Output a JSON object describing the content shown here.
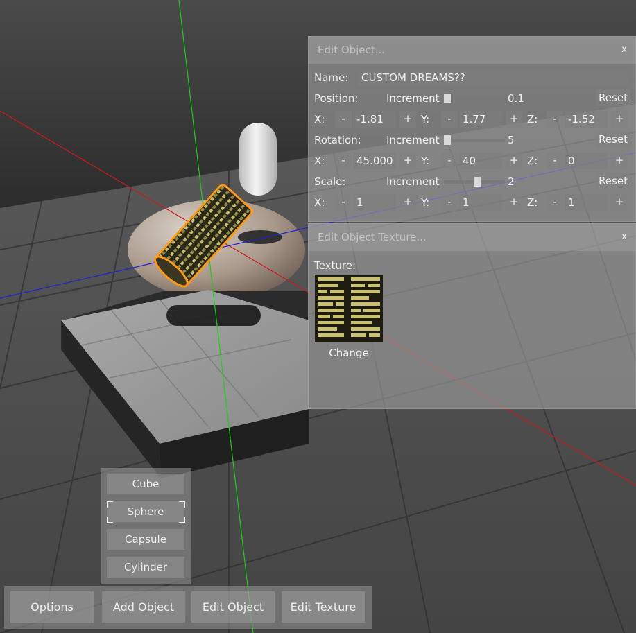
{
  "edit_object": {
    "title": "Edit Object...",
    "close": "x",
    "name_label": "Name:",
    "name_value": "CUSTOM DREAMS??",
    "position": {
      "label": "Position:",
      "increment_label": "Increment",
      "increment_value": "0.1",
      "increment_fraction": 0.0,
      "reset": "Reset",
      "x_label": "X:",
      "x": "-1.81",
      "y_label": "Y:",
      "y": "1.77",
      "z_label": "Z:",
      "z": "-1.52"
    },
    "rotation": {
      "label": "Rotation:",
      "increment_label": "Increment",
      "increment_value": "5",
      "increment_fraction": 0.0,
      "reset": "Reset",
      "x_label": "X:",
      "x": "45.000",
      "y_label": "Y:",
      "y": "40",
      "z_label": "Z:",
      "z": "0"
    },
    "scale": {
      "label": "Scale:",
      "increment_label": "Increment",
      "increment_value": "2",
      "increment_fraction": 0.55,
      "reset": "Reset",
      "x_label": "X:",
      "x": "1",
      "y_label": "Y:",
      "y": "1",
      "z_label": "Z:",
      "z": "1"
    },
    "minus": "-",
    "plus": "+"
  },
  "edit_texture": {
    "title": "Edit Object Texture...",
    "close": "x",
    "texture_label": "Texture:",
    "change_button": "Change"
  },
  "shape_menu": {
    "items": [
      "Cube",
      "Sphere",
      "Capsule",
      "Cylinder"
    ],
    "selected": "Sphere"
  },
  "bottom_bar": {
    "options": "Options",
    "add_object": "Add Object",
    "edit_object": "Edit Object",
    "edit_texture": "Edit Texture"
  },
  "colors": {
    "axis_x": "#d01818",
    "axis_y": "#18d018",
    "axis_z": "#2020d0",
    "selection_outline": "#ff9a10"
  }
}
